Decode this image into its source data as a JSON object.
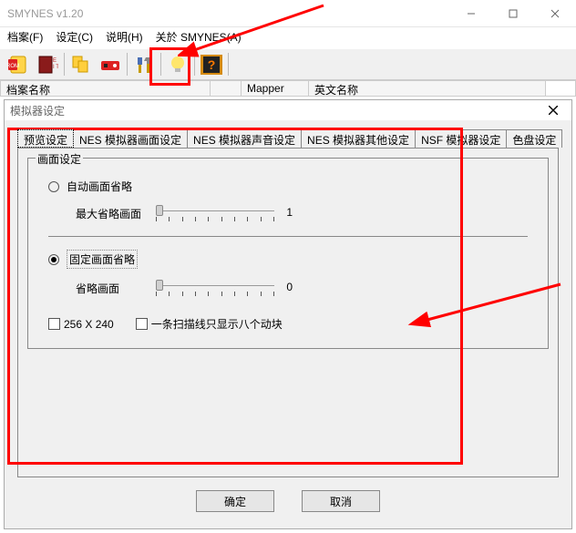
{
  "window": {
    "title": "SMYNES v1.20"
  },
  "menu": {
    "file": "档案(F)",
    "setting": "设定(C)",
    "help": "说明(H)",
    "about": "关於 SMYNES(A)"
  },
  "columns": {
    "name": "档案名称",
    "mapper": "Mapper",
    "english": "英文名称"
  },
  "icons": {
    "rom": "rom-icon",
    "exit": "exit-icon",
    "copy": "copy-icon",
    "nes": "nes-icon",
    "tools": "tools-icon",
    "bulb": "bulb-icon",
    "question": "question-icon"
  },
  "dialog": {
    "title": "模拟器设定",
    "tabs": {
      "preview": "预览设定",
      "nes_video": "NES 模拟器画面设定",
      "nes_audio": "NES 模拟器声音设定",
      "nes_other": "NES 模拟器其他设定",
      "nsf": "NSF 模拟器设定",
      "disk": "色盘设定"
    },
    "group_label": "画面设定",
    "opt_auto": "自动画面省略",
    "auto_sub": "最大省略画面",
    "auto_value": "1",
    "opt_fixed": "固定画面省略",
    "fixed_sub": "省略画面",
    "fixed_value": "0",
    "chk_256": "256 X 240",
    "chk_scan": "一条扫描线只显示八个动块",
    "ok": "确定",
    "cancel": "取消"
  }
}
